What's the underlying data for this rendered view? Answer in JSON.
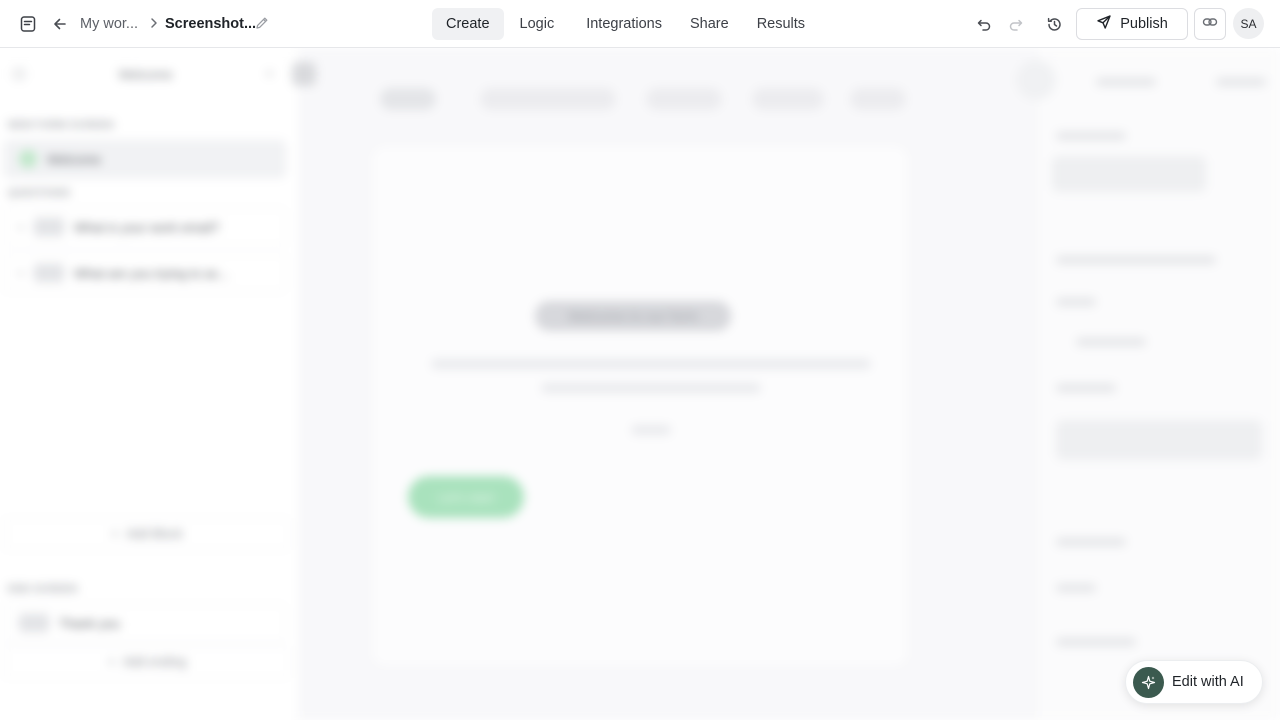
{
  "header": {
    "breadcrumb_workspace": "My wor...",
    "form_title": "Screenshot...",
    "tabs": [
      {
        "label": "Create",
        "active": true
      },
      {
        "label": "Logic",
        "active": false
      },
      {
        "label": "Integrations",
        "active": false
      },
      {
        "label": "Share",
        "active": false
      },
      {
        "label": "Results",
        "active": false
      }
    ],
    "publish_label": "Publish",
    "avatar_initials": "SA",
    "icons": [
      "form-icon",
      "back-arrow-icon",
      "chevron-right-icon",
      "pencil-icon",
      "undo-icon",
      "redo-icon",
      "history-icon",
      "send-icon",
      "link-icon"
    ]
  },
  "left_panel": {
    "dropdown_label": "Welcome",
    "section_welcome_label": "NEW FORM SCREEN",
    "welcome_item": "Welcome",
    "section_questions_label": "QUESTIONS",
    "questions": [
      {
        "label": "What is your work email?"
      },
      {
        "label": "What are you trying to ac..."
      }
    ],
    "add_block_label": "Add Block",
    "section_end_label": "END SCREEN",
    "end_item": "Thank you",
    "add_ending_label": "Add ending"
  },
  "canvas": {
    "welcome_title": "Welcome to our form",
    "create_button_label": "Let's start"
  },
  "ai_button": {
    "label": "Edit with AI"
  },
  "colors": {
    "accent_green": "#a9e2bd",
    "ai_button_bg": "#3b5a4f"
  }
}
